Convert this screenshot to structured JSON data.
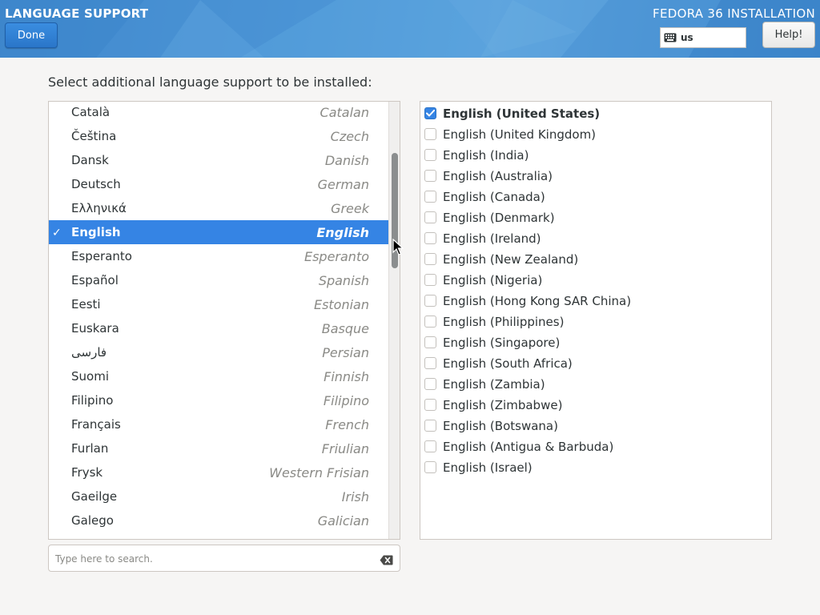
{
  "header": {
    "title": "LANGUAGE SUPPORT",
    "product": "FEDORA 36 INSTALLATION",
    "done_label": "Done",
    "help_label": "Help!",
    "keyboard_layout": "us",
    "keyboard_icon": "keyboard-icon",
    "gradient_colors": [
      "#3b83c9",
      "#5aa2dd"
    ]
  },
  "prompt": "Select additional language support to be installed:",
  "accent_color": "#3584e4",
  "languages": [
    {
      "native": "Català",
      "english": "Catalan",
      "selected": false
    },
    {
      "native": "Čeština",
      "english": "Czech",
      "selected": false
    },
    {
      "native": "Dansk",
      "english": "Danish",
      "selected": false
    },
    {
      "native": "Deutsch",
      "english": "German",
      "selected": false
    },
    {
      "native": "Ελληνικά",
      "english": "Greek",
      "selected": false
    },
    {
      "native": "English",
      "english": "English",
      "selected": true
    },
    {
      "native": "Esperanto",
      "english": "Esperanto",
      "selected": false
    },
    {
      "native": "Español",
      "english": "Spanish",
      "selected": false
    },
    {
      "native": "Eesti",
      "english": "Estonian",
      "selected": false
    },
    {
      "native": "Euskara",
      "english": "Basque",
      "selected": false
    },
    {
      "native": "فارسی",
      "english": "Persian",
      "selected": false
    },
    {
      "native": "Suomi",
      "english": "Finnish",
      "selected": false
    },
    {
      "native": "Filipino",
      "english": "Filipino",
      "selected": false
    },
    {
      "native": "Français",
      "english": "French",
      "selected": false
    },
    {
      "native": "Furlan",
      "english": "Friulian",
      "selected": false
    },
    {
      "native": "Frysk",
      "english": "Western Frisian",
      "selected": false
    },
    {
      "native": "Gaeilge",
      "english": "Irish",
      "selected": false
    },
    {
      "native": "Galego",
      "english": "Galician",
      "selected": false
    }
  ],
  "search": {
    "placeholder": "Type here to search.",
    "value": "",
    "clear_icon": "clear-text-icon"
  },
  "locales": [
    {
      "label": "English (United States)",
      "checked": true
    },
    {
      "label": "English (United Kingdom)",
      "checked": false
    },
    {
      "label": "English (India)",
      "checked": false
    },
    {
      "label": "English (Australia)",
      "checked": false
    },
    {
      "label": "English (Canada)",
      "checked": false
    },
    {
      "label": "English (Denmark)",
      "checked": false
    },
    {
      "label": "English (Ireland)",
      "checked": false
    },
    {
      "label": "English (New Zealand)",
      "checked": false
    },
    {
      "label": "English (Nigeria)",
      "checked": false
    },
    {
      "label": "English (Hong Kong SAR China)",
      "checked": false
    },
    {
      "label": "English (Philippines)",
      "checked": false
    },
    {
      "label": "English (Singapore)",
      "checked": false
    },
    {
      "label": "English (South Africa)",
      "checked": false
    },
    {
      "label": "English (Zambia)",
      "checked": false
    },
    {
      "label": "English (Zimbabwe)",
      "checked": false
    },
    {
      "label": "English (Botswana)",
      "checked": false
    },
    {
      "label": "English (Antigua & Barbuda)",
      "checked": false
    },
    {
      "label": "English (Israel)",
      "checked": false
    }
  ]
}
